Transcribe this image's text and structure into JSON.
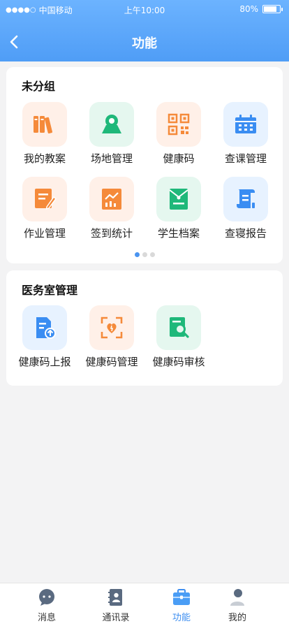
{
  "status": {
    "carrier": "中国移动",
    "time": "上午10:00",
    "battery": "80%",
    "battery_level": 0.8
  },
  "header": {
    "title": "功能"
  },
  "group1": {
    "title": "未分组",
    "items": [
      {
        "label": "我的教案",
        "icon": "books-icon"
      },
      {
        "label": "场地管理",
        "icon": "location-icon"
      },
      {
        "label": "健康码",
        "icon": "qr-code-icon"
      },
      {
        "label": "查课管理",
        "icon": "calendar-icon"
      },
      {
        "label": "作业管理",
        "icon": "edit-document-icon"
      },
      {
        "label": "签到统计",
        "icon": "chart-icon"
      },
      {
        "label": "学生档案",
        "icon": "archive-icon"
      },
      {
        "label": "查寝报告",
        "icon": "report-scroll-icon"
      }
    ]
  },
  "group2": {
    "title": "医务室管理",
    "items": [
      {
        "label": "健康码上报",
        "icon": "upload-document-icon"
      },
      {
        "label": "健康码管理",
        "icon": "face-scan-icon"
      },
      {
        "label": "健康码审核",
        "icon": "search-document-icon"
      }
    ]
  },
  "pager": {
    "count": 3,
    "active": 0
  },
  "tabbar": {
    "tabs": [
      {
        "label": "消息",
        "icon": "message-icon"
      },
      {
        "label": "通讯录",
        "icon": "contacts-icon"
      },
      {
        "label": "功能",
        "icon": "briefcase-icon",
        "active": true
      },
      {
        "label": "我的",
        "icon": "user-icon"
      }
    ]
  },
  "colors": {
    "header_gradient_top": "#6cb3ff",
    "header_gradient_bottom": "#4f9df6",
    "orange_icon": "#f58a3a",
    "green_icon": "#1fb87a",
    "blue_icon": "#3a8df2",
    "active_tab": "#3f8ff0"
  }
}
